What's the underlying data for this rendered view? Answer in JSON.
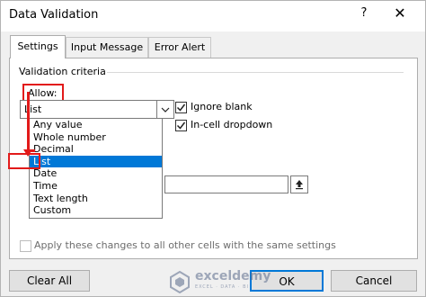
{
  "window": {
    "title": "Data Validation",
    "help_label": "?",
    "close_label": "✕"
  },
  "tabs": [
    {
      "label": "Settings",
      "active": true
    },
    {
      "label": "Input Message",
      "active": false
    },
    {
      "label": "Error Alert",
      "active": false
    }
  ],
  "settings": {
    "section_label": "Validation criteria",
    "allow_label": "Allow:",
    "allow_value": "List",
    "allow_options": [
      "Any value",
      "Whole number",
      "Decimal",
      "List",
      "Date",
      "Time",
      "Text length",
      "Custom"
    ],
    "selected_option": "List",
    "ignore_blank": {
      "label": "Ignore blank",
      "checked": true
    },
    "in_cell_dropdown": {
      "label": "In-cell dropdown",
      "checked": true
    },
    "apply_all": {
      "label": "Apply these changes to all other cells with the same settings",
      "checked": false
    }
  },
  "buttons": {
    "clear_all": "Clear All",
    "ok": "OK",
    "cancel": "Cancel"
  },
  "watermark": {
    "name": "exceldemy",
    "tagline": "EXCEL · DATA · BI"
  },
  "colors": {
    "highlight_red": "#e21a1a",
    "selection_blue": "#0078d7"
  },
  "icons": {
    "dropdown": "chevron-down-icon",
    "collapse": "range-collapse-icon",
    "check": "checkmark-icon"
  }
}
